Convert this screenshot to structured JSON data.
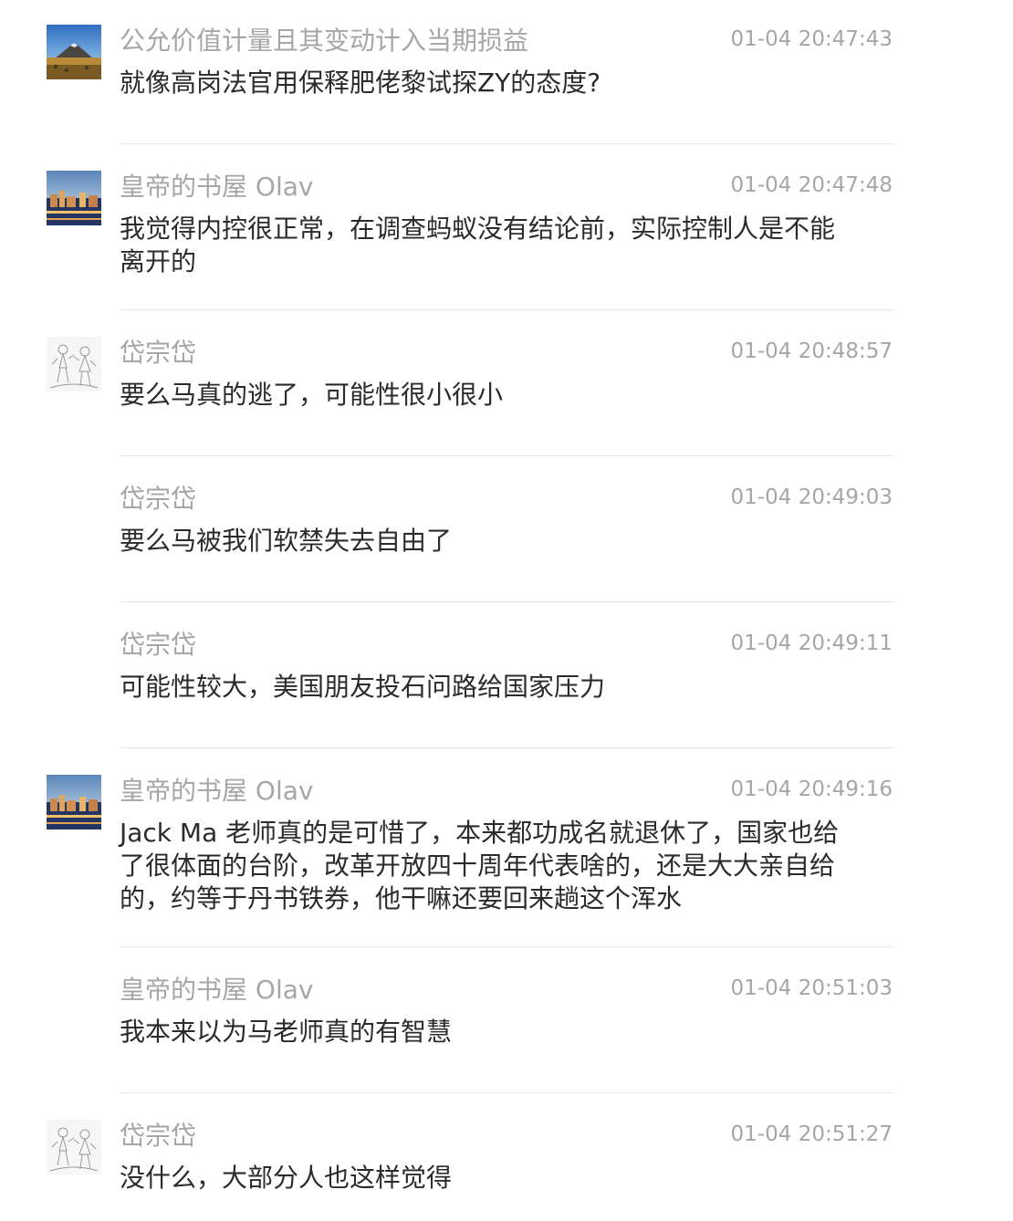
{
  "comments": [
    {
      "avatar": "mountain-landscape-avatar",
      "name": "公允价值计量且其变动计入当期损益",
      "time": "01-04 20:47:43",
      "text": "就像高岗法官用保释肥佬黎试探ZY的态度?"
    },
    {
      "avatar": "city-night-avatar",
      "name": "皇帝的书屋 Olav",
      "time": "01-04 20:47:48",
      "text": "我觉得内控很正常，在调查蚂蚁没有结论前，实际控制人是不能离开的"
    },
    {
      "avatar": "sketch-figures-avatar",
      "name": "岱宗岱",
      "time": "01-04 20:48:57",
      "text": "要么马真的逃了，可能性很小很小"
    },
    {
      "avatar": "",
      "name": "岱宗岱",
      "time": "01-04 20:49:03",
      "text": "要么马被我们软禁失去自由了"
    },
    {
      "avatar": "",
      "name": "岱宗岱",
      "time": "01-04 20:49:11",
      "text": "可能性较大，美国朋友投石问路给国家压力"
    },
    {
      "avatar": "city-night-avatar",
      "name": "皇帝的书屋 Olav",
      "time": "01-04 20:49:16",
      "text": "Jack Ma 老师真的是可惜了，本来都功成名就退休了，国家也给了很体面的台阶，改革开放四十周年代表啥的，还是大大亲自给的，约等于丹书铁券，他干嘛还要回来趟这个浑水"
    },
    {
      "avatar": "",
      "name": "皇帝的书屋 Olav",
      "time": "01-04 20:51:03",
      "text": "我本来以为马老师真的有智慧"
    },
    {
      "avatar": "sketch-figures-avatar",
      "name": "岱宗岱",
      "time": "01-04 20:51:27",
      "text": "没什么，大部分人也这样觉得"
    }
  ]
}
